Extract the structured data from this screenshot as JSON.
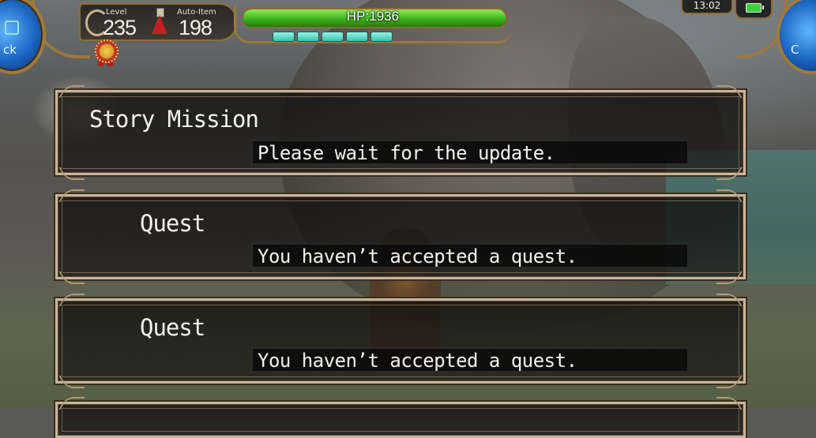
{
  "hud": {
    "level_label": "Level",
    "level_value": "235",
    "auto_item_label": "Auto-Item",
    "auto_item_value": "198",
    "hp_text": "HP:1936",
    "hp_fraction": 1.0,
    "sp_segments": 5,
    "time": "13:02",
    "left_button_text": "ck",
    "right_button_text": "C"
  },
  "missions": [
    {
      "title": "Story Mission",
      "message": "Please wait for the update."
    },
    {
      "title": "Quest",
      "message": "You haven’t accepted a quest."
    },
    {
      "title": "Quest",
      "message": "You haven’t accepted a quest."
    }
  ],
  "colors": {
    "hp_green": "#3fb21d",
    "sp_teal": "#38c2a9",
    "gold_frame": "#9a7838",
    "panel_border": "#c9b59a"
  }
}
